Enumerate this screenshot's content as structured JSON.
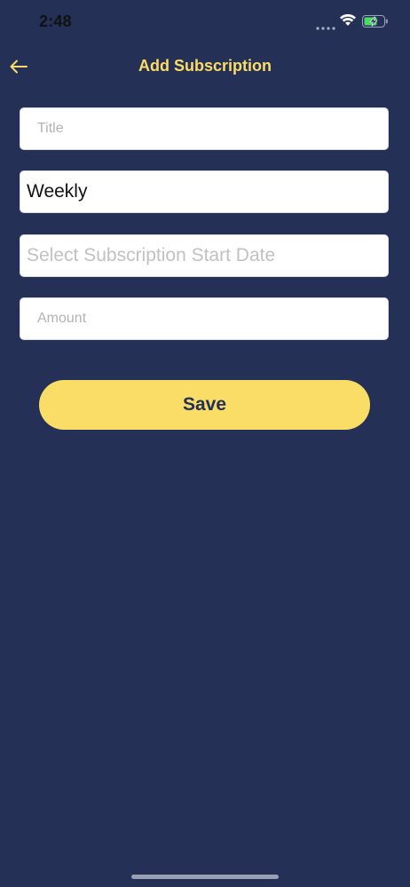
{
  "status_bar": {
    "time": "2:48"
  },
  "nav": {
    "title": "Add Subscription",
    "back_icon": "arrow-left-icon"
  },
  "form": {
    "title_field": {
      "value": "",
      "placeholder": "Title"
    },
    "frequency_field": {
      "value": "Weekly"
    },
    "start_date_field": {
      "placeholder": "Select Subscription Start Date"
    },
    "amount_field": {
      "value": "",
      "placeholder": "Amount"
    },
    "save_label": "Save"
  },
  "colors": {
    "background": "#253057",
    "accent": "#F9DD66",
    "field_background": "#FFFFFF",
    "placeholder": "#B3B3B3"
  }
}
